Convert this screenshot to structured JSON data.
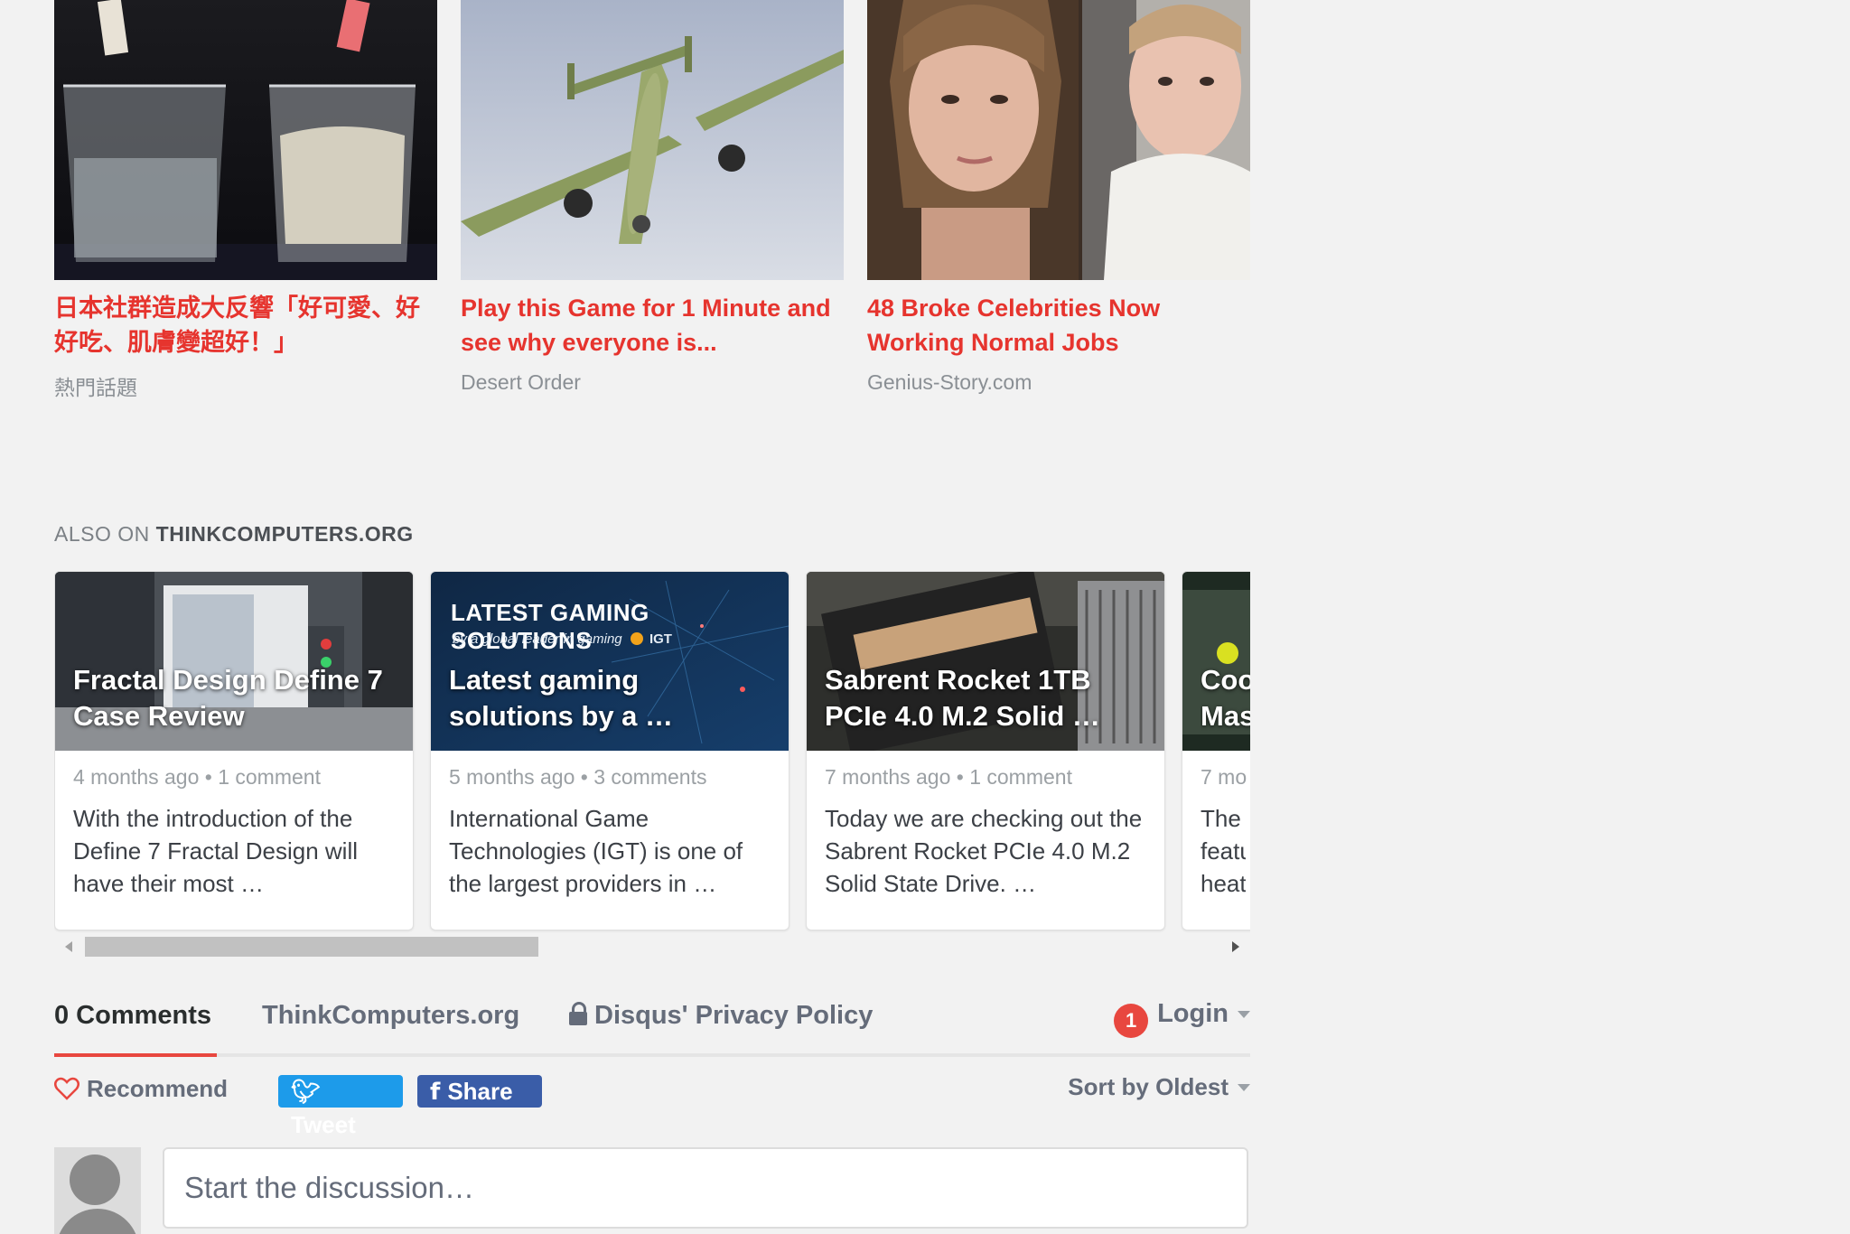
{
  "sponsored": {
    "cards": [
      {
        "title": "日本社群造成大反響「好可愛、好好吃、肌膚變超好！」",
        "source": "熱門話題"
      },
      {
        "title": "Play this Game for 1 Minute and see why everyone is...",
        "source": "Desert Order"
      },
      {
        "title": "48 Broke Celebrities Now Working Normal Jobs",
        "source": "Genius-Story.com"
      }
    ]
  },
  "also_on": {
    "prefix": "ALSO ON",
    "site": "THINKCOMPUTERS.ORG"
  },
  "recommendations": [
    {
      "thumb_title": "Fractal Design Define 7 Case Review",
      "meta": "4 months ago • 1 comment",
      "desc": "With the introduction of the Define 7 Fractal Design will have their most …"
    },
    {
      "thumb_title": "Latest gaming solutions by a …",
      "meta": "5 months ago • 3 comments",
      "desc": "International Game Technologies (IGT) is one of the largest providers in …",
      "banner_title": "LATEST GAMING SOLUTIONS",
      "banner_sub": "by a global leader in gaming",
      "banner_brand": "IGT"
    },
    {
      "thumb_title": "Sabrent Rocket 1TB PCIe 4.0 M.2 Solid …",
      "meta": "7 months ago • 1 comment",
      "desc": "Today we are checking out the Sabrent Rocket PCIe 4.0 M.2 Solid State Drive. …"
    },
    {
      "thumb_title": "Coo Mas",
      "meta": "7 mo",
      "desc": "The featu heat"
    }
  ],
  "comments_nav": {
    "count_tab": "0 Comments",
    "site_tab": "ThinkComputers.org",
    "privacy": "Disqus' Privacy Policy",
    "notification_count": "1",
    "login": "Login"
  },
  "actions": {
    "recommend": "Recommend",
    "tweet": "Tweet",
    "share": "Share",
    "sort": "Sort by Oldest"
  },
  "composer": {
    "placeholder": "Start the discussion…"
  },
  "colors": {
    "accent_red": "#e8473f",
    "title_red": "#e6342e",
    "tweet_blue": "#1d9bea",
    "facebook_blue": "#3a5da8"
  }
}
